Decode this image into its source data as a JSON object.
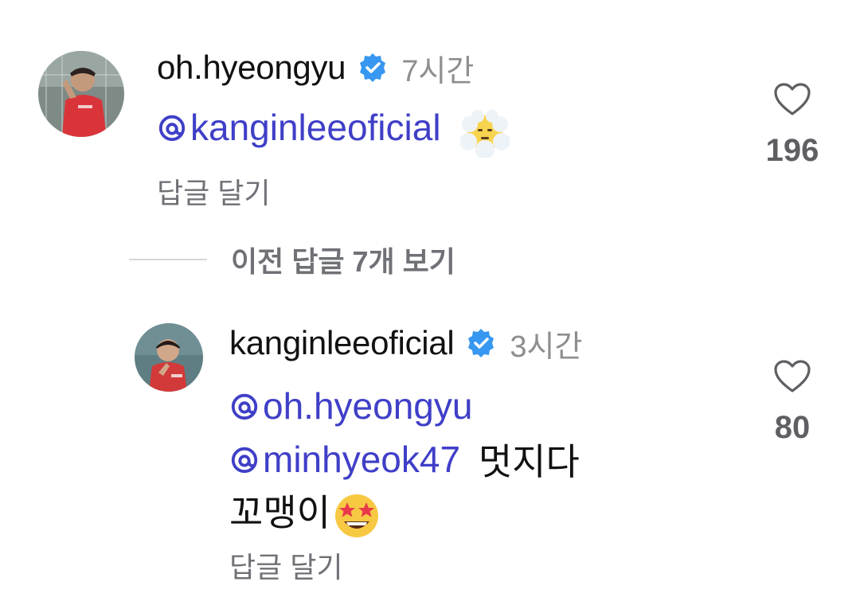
{
  "comments": [
    {
      "username": "oh.hyeongyu",
      "timestamp": "7시간",
      "mentions": [
        "kanginleeoficial"
      ],
      "text": "",
      "reply_label": "답글 달기",
      "like_count": "196"
    },
    {
      "username": "kanginleeoficial",
      "timestamp": "3시간",
      "mentions": [
        "oh.hyeongyu",
        "minhyeok47"
      ],
      "text_line2_tail": "멋지다",
      "text_line3": "꼬맹이",
      "reply_label": "답글 달기",
      "like_count": "80"
    }
  ],
  "view_previous": "이전 답글 7개 보기",
  "colors": {
    "mention": "#3f3fc8",
    "verified": "#3897f0",
    "muted": "#8e8e8e"
  },
  "icons": {
    "verified": "verified-badge-icon",
    "mention": "threads-at-icon",
    "like": "heart-outline-icon",
    "emoji1": "face-in-clouds-emoji",
    "emoji2": "star-struck-emoji"
  }
}
